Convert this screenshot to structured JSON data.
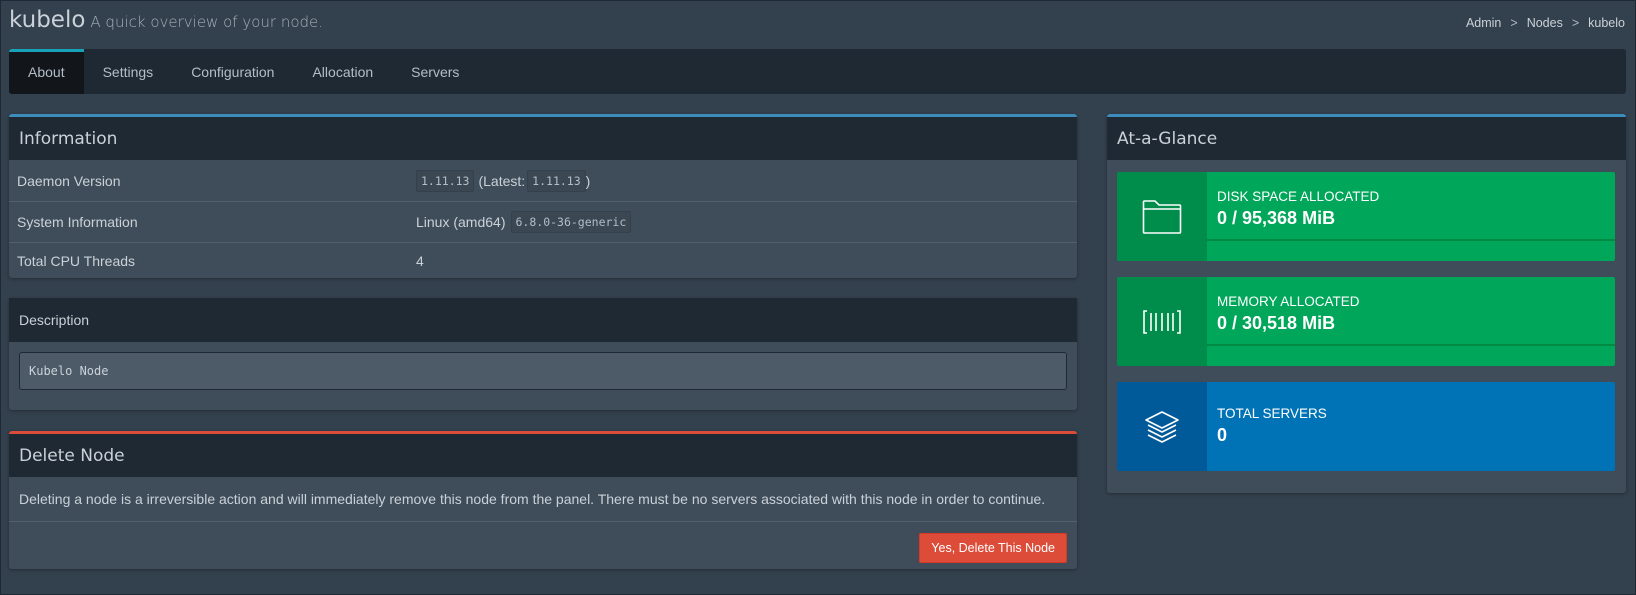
{
  "header": {
    "title": "kubelo",
    "subtitle": "A quick overview of your node."
  },
  "breadcrumb": [
    "Admin",
    "Nodes",
    "kubelo"
  ],
  "breadcrumb_separator": ">",
  "tabs": [
    {
      "label": "About",
      "active": true
    },
    {
      "label": "Settings",
      "active": false
    },
    {
      "label": "Configuration",
      "active": false
    },
    {
      "label": "Allocation",
      "active": false
    },
    {
      "label": "Servers",
      "active": false
    }
  ],
  "information": {
    "title": "Information",
    "rows": [
      {
        "label": "Daemon Version",
        "version": "1.11.13",
        "latest_prefix": "(Latest:",
        "latest": "1.11.13",
        "latest_suffix": ")"
      },
      {
        "label": "System Information",
        "os": "Linux (amd64)",
        "kernel": "6.8.0-36-generic"
      },
      {
        "label": "Total CPU Threads",
        "value": "4"
      }
    ]
  },
  "description": {
    "title": "Description",
    "value": "Kubelo Node"
  },
  "delete": {
    "title": "Delete Node",
    "text": "Deleting a node is a irreversible action and will immediately remove this node from the panel. There must be no servers associated with this node in order to continue.",
    "button_label": "Yes, Delete This Node"
  },
  "glance": {
    "title": "At-a-Glance",
    "stats": [
      {
        "label": "DISK SPACE ALLOCATED",
        "value": "0 / 95,368 MiB",
        "icon": "folder-icon",
        "progress_percent": 0,
        "color": "#00a65a"
      },
      {
        "label": "MEMORY ALLOCATED",
        "value": "0 / 30,518 MiB",
        "icon": "barcode-icon",
        "progress_percent": 0,
        "color": "#00a65a"
      },
      {
        "label": "TOTAL SERVERS",
        "value": "0",
        "icon": "layers-icon",
        "color": "#0073b7"
      }
    ]
  },
  "colors": {
    "primary_accent": "#3c8dbc",
    "danger": "#dd4b39",
    "tab_active_accent": "#17a2b8",
    "success": "#00a65a",
    "info": "#0073b7"
  }
}
